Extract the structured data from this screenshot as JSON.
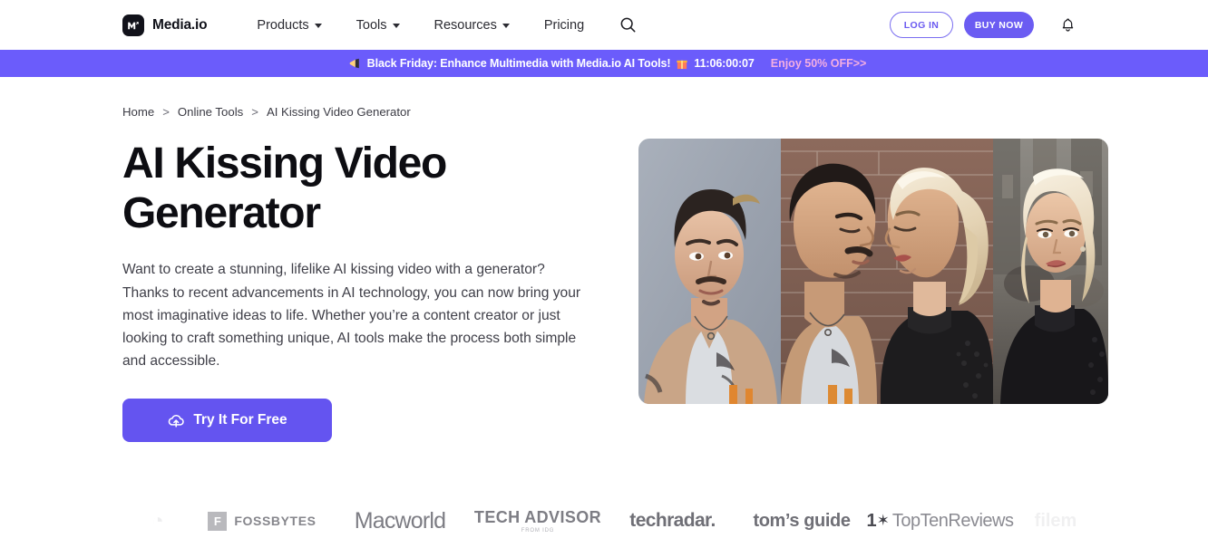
{
  "header": {
    "brand_name": "Media.io",
    "brand_icon": "media-io-logo-icon",
    "nav_items": [
      {
        "label": "Products",
        "has_caret": true
      },
      {
        "label": "Tools",
        "has_caret": true
      },
      {
        "label": "Resources",
        "has_caret": true
      },
      {
        "label": "Pricing",
        "has_caret": false
      }
    ],
    "search_icon": "search-icon",
    "login_label": "LOG IN",
    "buy_label": "BUY NOW",
    "bell_icon": "notification-bell-icon"
  },
  "promo": {
    "megaphone_icon": "megaphone-emoji",
    "text": "Black Friday: Enhance Multimedia with Media.io AI Tools!",
    "gift_icon": "gift-emoji",
    "countdown": "11:06:00:07",
    "cta": "Enjoy 50% OFF>>",
    "bg_color": "#6b5cfb",
    "cta_color": "#f4aee2"
  },
  "breadcrumb": {
    "items": [
      "Home",
      "Online Tools",
      "AI Kissing Video Generator"
    ],
    "separator": ">"
  },
  "hero": {
    "title": "AI Kissing Video Generator",
    "description": "Want to create a stunning, lifelike AI kissing video with a generator? Thanks to recent advancements in AI technology, you can now bring your most imaginative ideas to life. Whether you’re a content creator or just looking to craft something unique, AI tools make the process both simple and accessible.",
    "cta_label": "Try It For Free",
    "cta_icon": "cloud-upload-icon",
    "cta_color": "#6454f0",
    "image_alt": "three-panel photo collage of a man portrait, a couple about to kiss, and a woman portrait"
  },
  "press": {
    "logos": [
      {
        "name": "edge-left-logo",
        "text": "◔"
      },
      {
        "name": "fossbytes-logo",
        "mark": "F",
        "text": "FOSSBYTES"
      },
      {
        "name": "macworld-logo",
        "text": "Macworld"
      },
      {
        "name": "tech-advisor-logo",
        "text": "TECH ADVISOR",
        "sub": "FROM IDG"
      },
      {
        "name": "techradar-logo",
        "text": "techradar."
      },
      {
        "name": "toms-guide-logo",
        "text": "tom’s guide"
      },
      {
        "name": "toptenreviews-logo",
        "ten": "1",
        "star": "✶",
        "rest": "TopTenReviews"
      },
      {
        "name": "edge-right-logo",
        "text": "filem"
      }
    ]
  }
}
